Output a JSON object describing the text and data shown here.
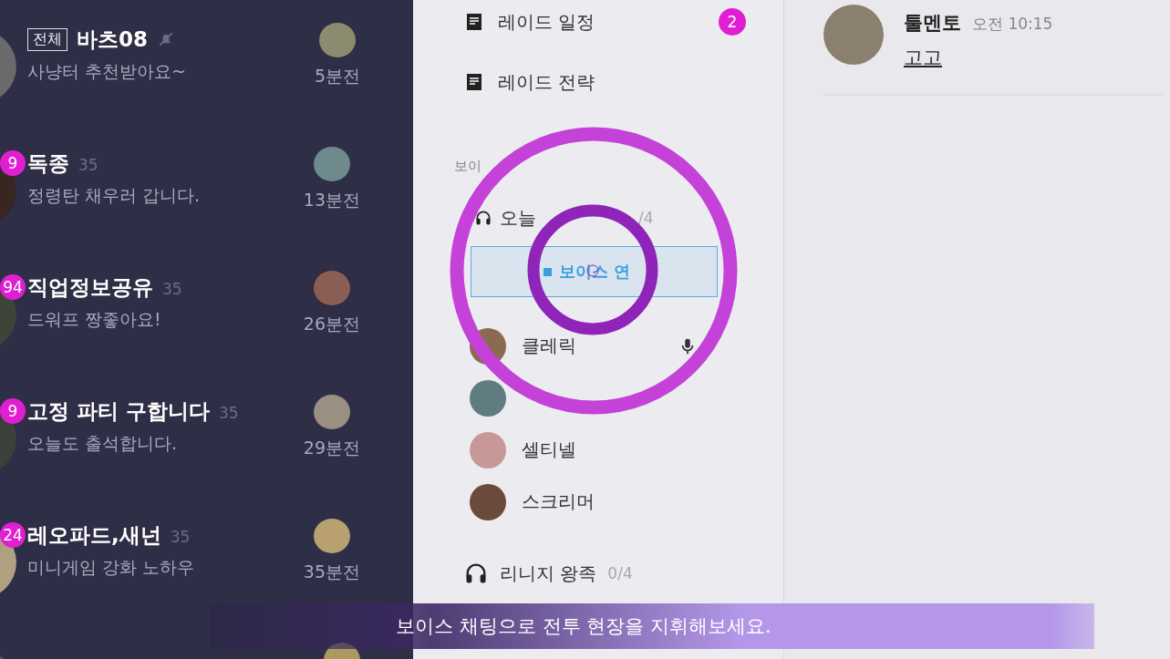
{
  "chat_list": [
    {
      "tag": "전체",
      "title": "바츠08",
      "muted": true,
      "preview": "사냥터 추천받아요~",
      "time": "5분전"
    },
    {
      "badge": "9",
      "title": "독종",
      "count": "35",
      "muted": false,
      "preview": "정령탄 채우러 갑니다.",
      "time": "13분전"
    },
    {
      "badge": "94",
      "title": "직업정보공유",
      "count": "35",
      "muted": false,
      "preview": "드워프 짱좋아요!",
      "time": "26분전"
    },
    {
      "badge": "9",
      "title": "고정 파티 구합니다",
      "count": "35",
      "muted": false,
      "preview": "오늘도 출석합니다.",
      "time": "29분전"
    },
    {
      "badge": "24",
      "title": "레오파드,새넌",
      "count": "35",
      "muted": false,
      "preview": "미니게임 강화 노하우",
      "time": "35분전"
    },
    {
      "muted": false
    }
  ],
  "channels": {
    "boards": [
      {
        "label": "레이드 일정",
        "badge": "2"
      },
      {
        "label": "레이드 전략"
      }
    ],
    "voice_section_label": "보이",
    "voice_channels": [
      {
        "name": "오늘",
        "count": "/4",
        "connect_button": "보이스 연",
        "members": [
          {
            "name": "클레릭",
            "mic": true
          },
          {
            "mic": false
          },
          {
            "name": "셀티넬",
            "mic": false
          },
          {
            "name": "스크리머",
            "mic": false
          }
        ]
      },
      {
        "name": "리니지 왕족",
        "count": "0/4"
      }
    ]
  },
  "message": {
    "author": "툴멘토",
    "time": "오전 10:15",
    "text": "고고"
  },
  "subtitle": "보이스 채팅으로 전투 현장을 지휘해보세요."
}
